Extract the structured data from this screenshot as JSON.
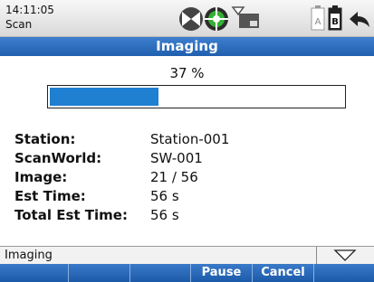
{
  "status_bar": {
    "time": "14:11:05",
    "app": "Scan",
    "icons": [
      "laser-on-icon",
      "target-icon",
      "wlan-icon",
      "memory-card-icon",
      "battery-a-icon",
      "battery-b-icon",
      "back-icon"
    ],
    "battery_a_label": "A",
    "battery_b_label": "B"
  },
  "title": "Imaging",
  "progress": {
    "label": "37 %",
    "fraction": 0.37,
    "fill_color": "#1f7fd0"
  },
  "info": [
    {
      "label": "Station:",
      "value": "Station-001"
    },
    {
      "label": "ScanWorld:",
      "value": "SW-001"
    },
    {
      "label": "Image:",
      "value": "21 / 56"
    },
    {
      "label": "Est Time:",
      "value": "56 s"
    },
    {
      "label": "Total Est Time:",
      "value": "56 s"
    }
  ],
  "statusline": {
    "text": "Imaging",
    "dropdown_icon": "triangle-down-icon"
  },
  "softkeys": [
    "",
    "",
    "",
    "Pause",
    "Cancel",
    ""
  ],
  "colors": {
    "title_bar": "#2a6cc0",
    "softkey_bar": "#2a6cc0"
  }
}
